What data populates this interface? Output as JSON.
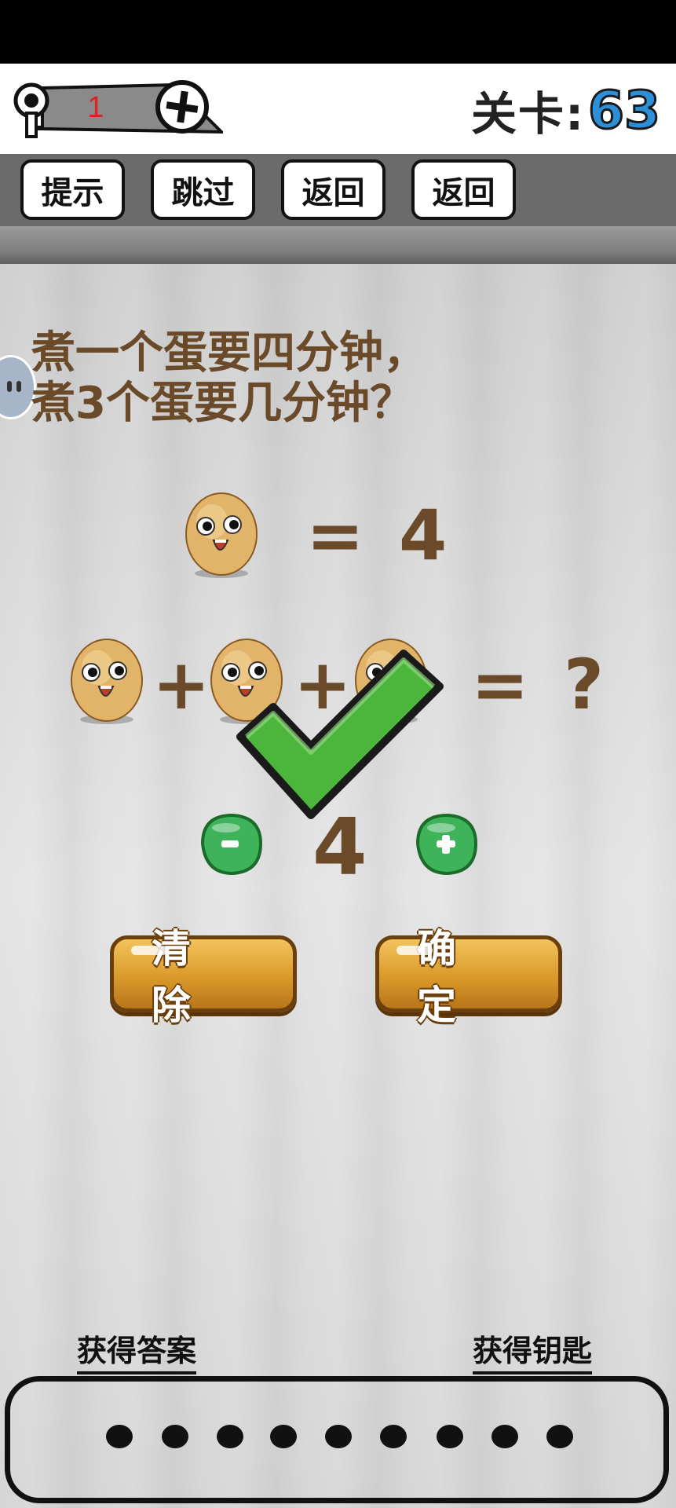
{
  "keys": {
    "count": "1"
  },
  "level": {
    "label": "关卡:",
    "number": "63"
  },
  "toolbar": {
    "hint": "提示",
    "skip": "跳过",
    "back1": "返回",
    "back2": "返回"
  },
  "question": {
    "line1": "煮一个蛋要四分钟，",
    "line2": "煮3个蛋要几分钟？"
  },
  "equation1": {
    "equals": "=",
    "value": "4"
  },
  "equation2": {
    "plus": "+",
    "equals": "=",
    "unknown": "?"
  },
  "answer": {
    "value": "4"
  },
  "buttons": {
    "clear": "清除",
    "confirm": "确定"
  },
  "bottom": {
    "get_answer": "获得答案",
    "get_key": "获得钥匙"
  },
  "hint_dots": 9,
  "colors": {
    "check": "#4bb53c",
    "level_number": "#2d8fd8",
    "egg": "#e2b46a",
    "wood": "#d99a2a"
  }
}
